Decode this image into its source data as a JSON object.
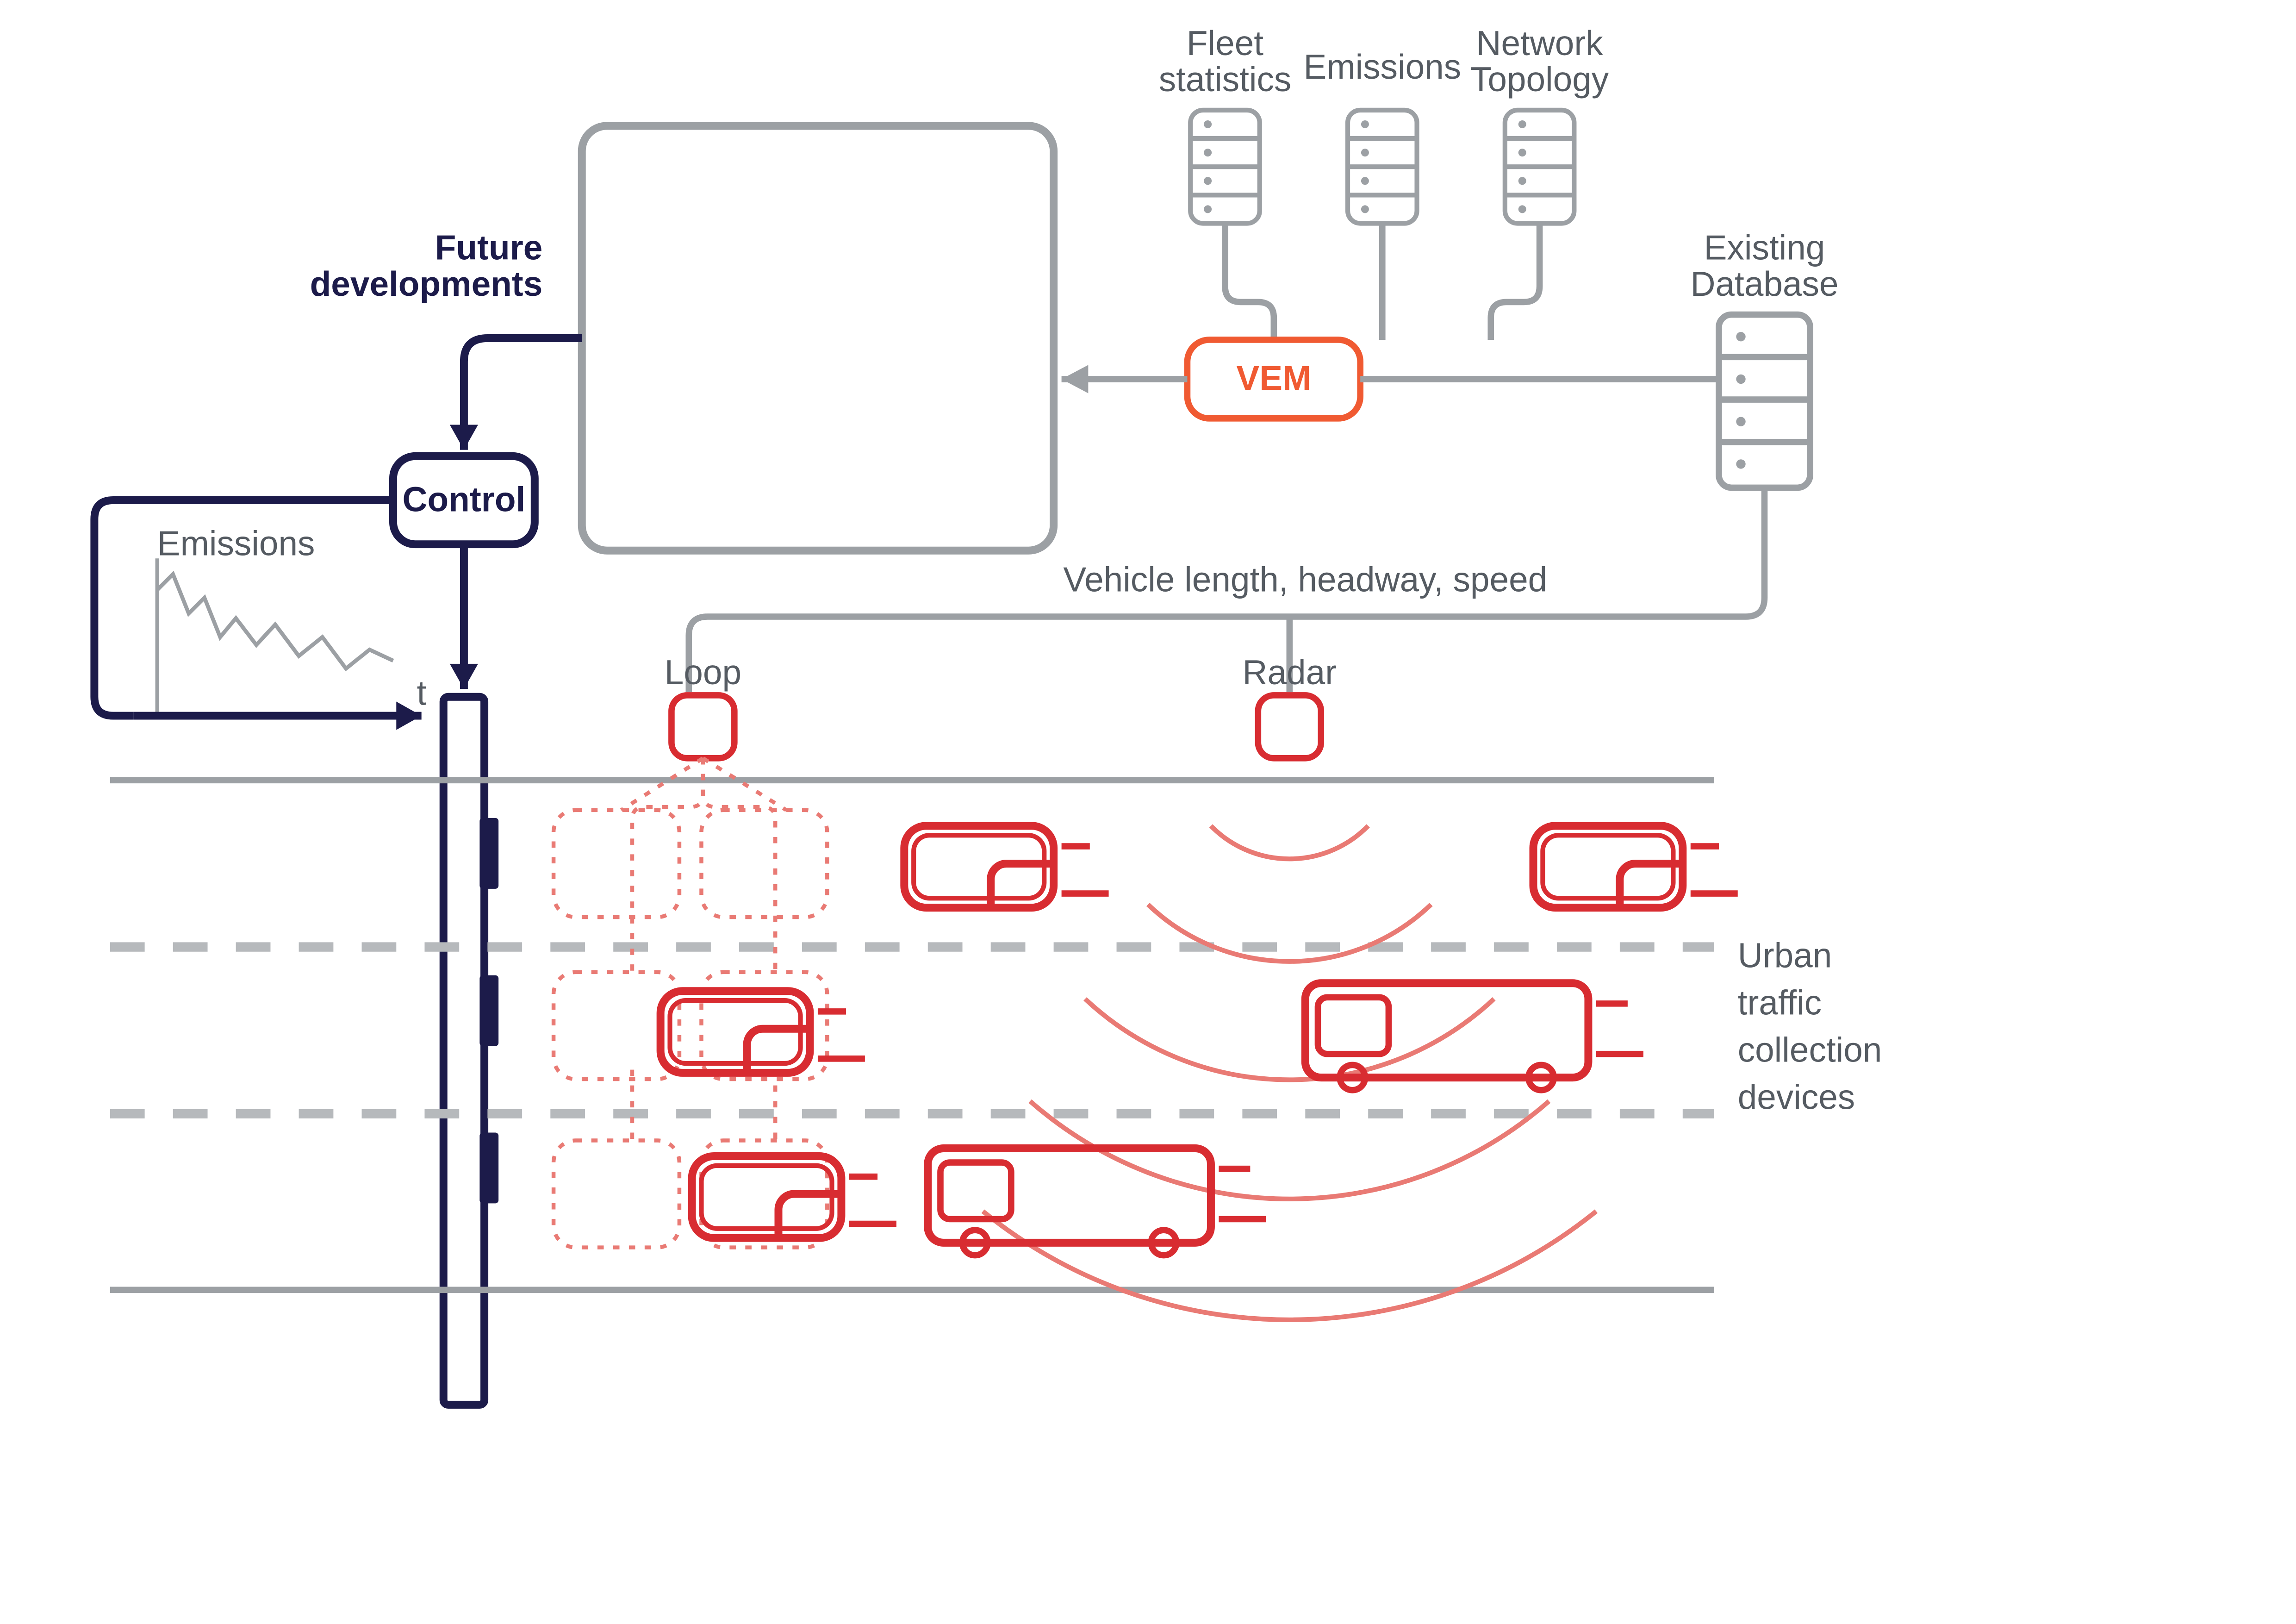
{
  "labels": {
    "fleet": "Fleet\nstatistics",
    "emissionsTop": "Emissions",
    "network": "Network\nTopology",
    "existing": "Existing\nDatabase",
    "vem": "VEM",
    "future": "Future\ndevelopments",
    "control": "Control",
    "emissionsChart": "Emissions",
    "t": "t",
    "loop": "Loop",
    "radar": "Radar",
    "dataLine": "Vehicle length, headway, speed",
    "side1": "Urban",
    "side2": "traffic",
    "side3": "collection",
    "side4": "devices"
  },
  "colors": {
    "grey": "#9ca0a4",
    "navy": "#1c1b4a",
    "orange": "#f05a32",
    "red": "#d82c31",
    "redLight": "#e97a74",
    "laneGrey": "#b6b9bc"
  }
}
